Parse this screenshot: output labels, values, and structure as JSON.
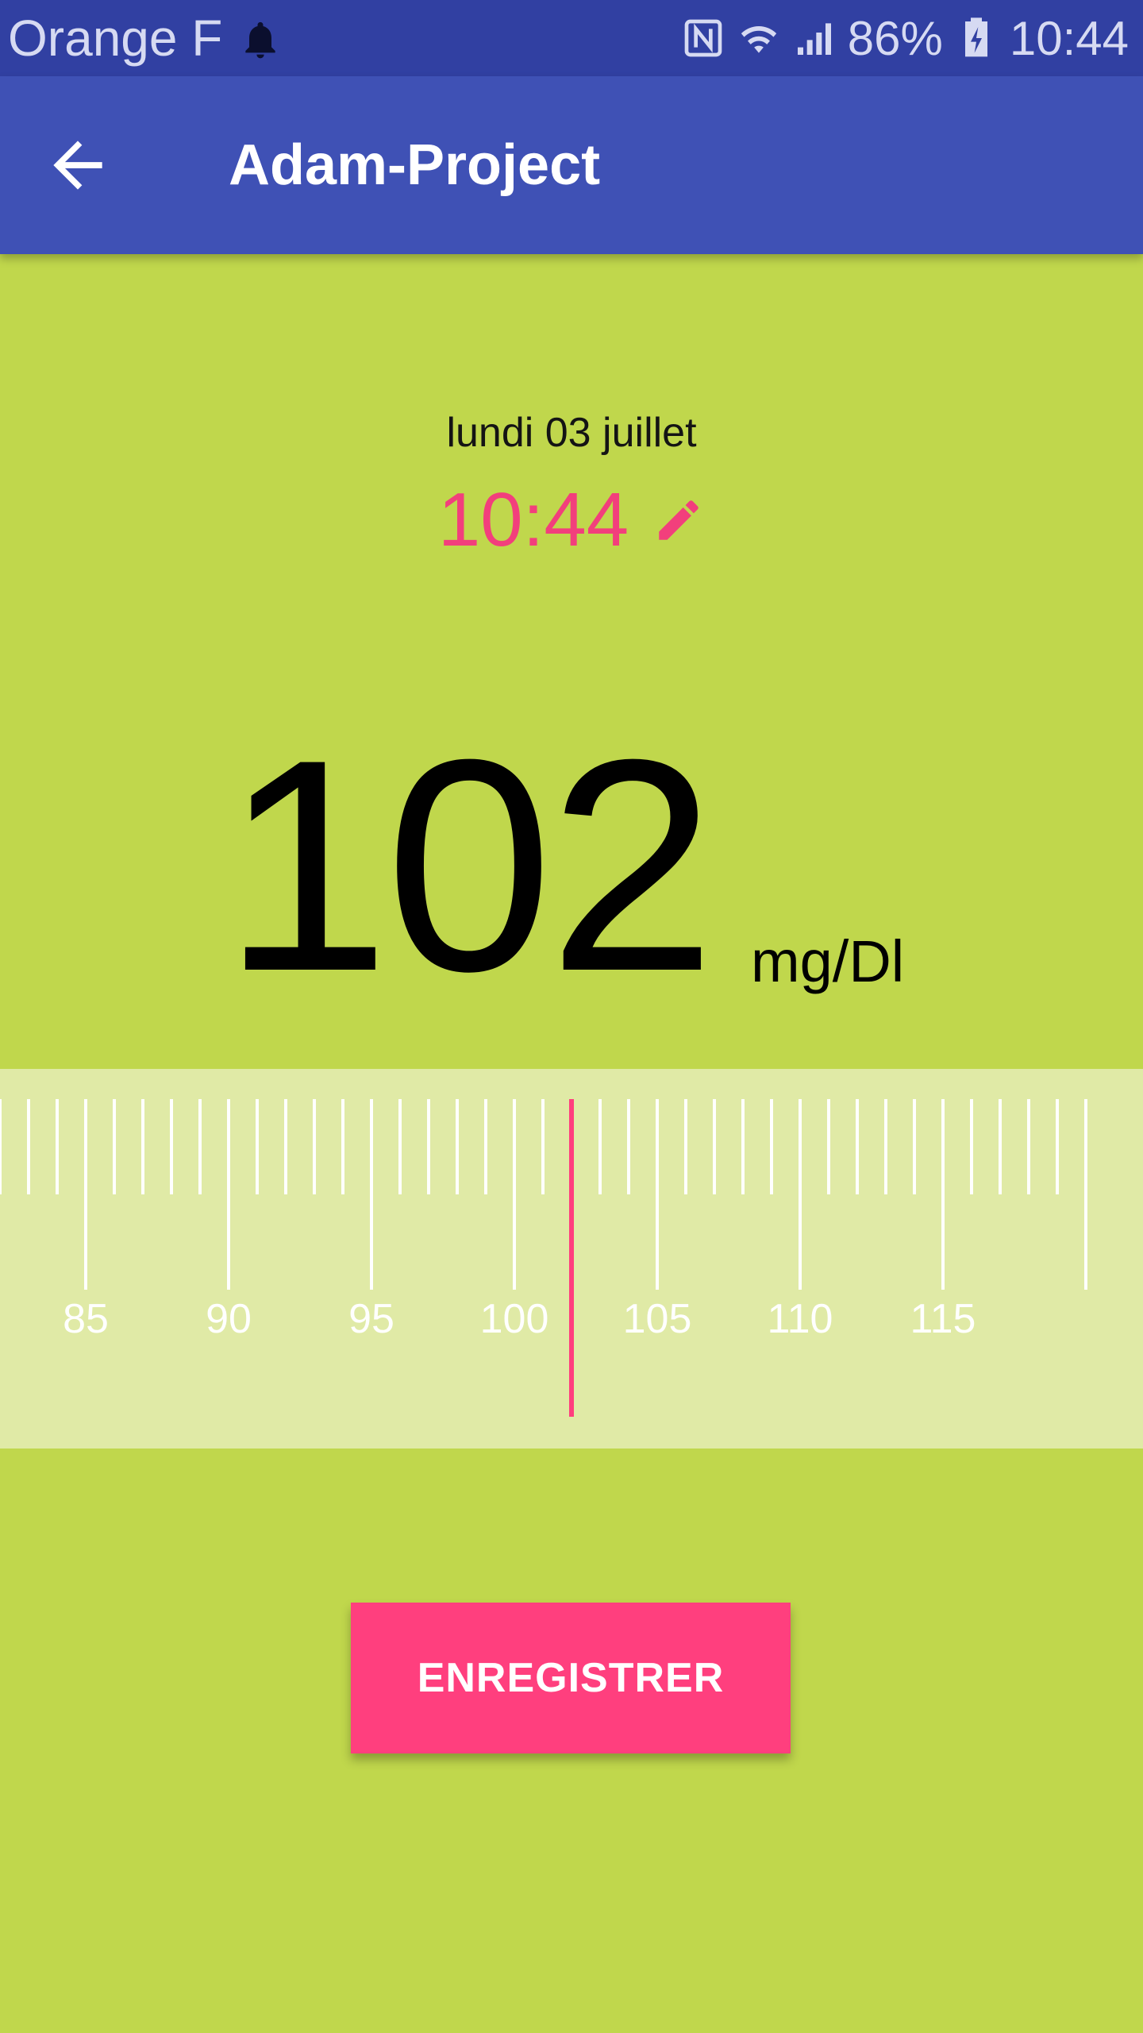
{
  "status_bar": {
    "carrier": "Orange F",
    "battery": "86%",
    "time": "10:44",
    "icons": [
      "bell-icon",
      "nfc-icon",
      "wifi-icon",
      "signal-icon",
      "battery-icon"
    ]
  },
  "app_bar": {
    "back_icon": "arrow-left-icon",
    "title": "Adam-Project"
  },
  "entry": {
    "date": "lundi 03 juillet",
    "time": "10:44",
    "edit_icon": "pencil-icon"
  },
  "reading": {
    "value": "102",
    "unit": "mg/Dl"
  },
  "ruler": {
    "min_visible": 82,
    "max_visible": 120,
    "major_step": 5,
    "labels": [
      "85",
      "90",
      "95",
      "100",
      "105",
      "110",
      "115"
    ],
    "selected": 102
  },
  "actions": {
    "save_label": "ENREGISTRER"
  },
  "colors": {
    "background": "#c0d74c",
    "status_bar": "#3140a2",
    "app_bar": "#3f51b5",
    "accent": "#ff3f7e",
    "ruler_band": "#e0eaa6"
  }
}
